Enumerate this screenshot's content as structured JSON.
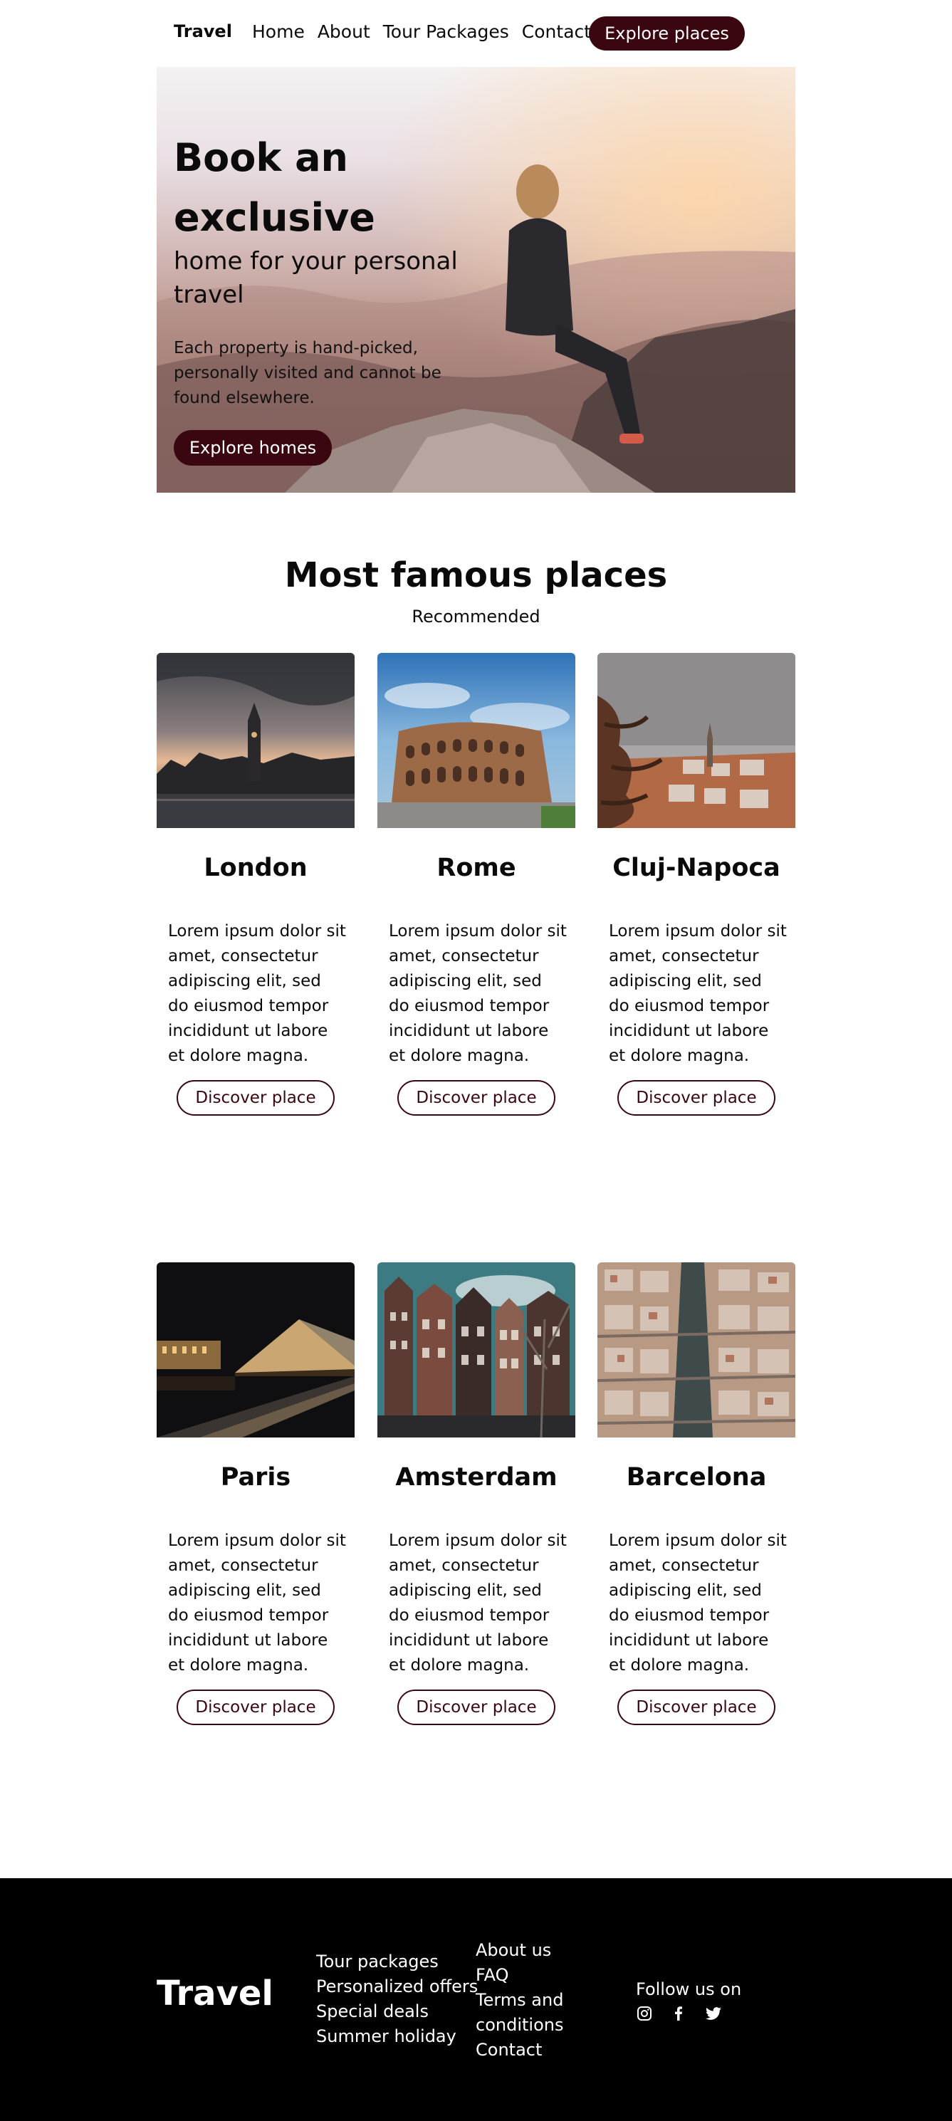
{
  "nav": {
    "brand": "Travel",
    "links": [
      "Home",
      "About",
      "Tour Packages",
      "Contact"
    ],
    "cta": "Explore places"
  },
  "hero": {
    "title": "Book an exclusive",
    "subtitle": "home for your personal travel",
    "description": "Each property is hand-picked, personally visited and cannot be found elsewhere.",
    "button": "Explore homes"
  },
  "places": {
    "title": "Most famous places",
    "subtitle": "Recommended",
    "cards": [
      {
        "name": "London",
        "desc": "Lorem ipsum dolor sit amet, consectetur adipiscing elit, sed do eiusmod tempor incididunt ut labore et dolore magna.",
        "button": "Discover place"
      },
      {
        "name": "Rome",
        "desc": "Lorem ipsum dolor sit amet, consectetur adipiscing elit, sed do eiusmod tempor incididunt ut labore et dolore magna.",
        "button": "Discover place"
      },
      {
        "name": "Cluj-Napoca",
        "desc": "Lorem ipsum dolor sit amet, consectetur adipiscing elit, sed do eiusmod tempor incididunt ut labore et dolore magna.",
        "button": "Discover place"
      },
      {
        "name": "Paris",
        "desc": "Lorem ipsum dolor sit amet, consectetur adipiscing elit, sed do eiusmod tempor incididunt ut labore et dolore magna.",
        "button": "Discover place"
      },
      {
        "name": "Amsterdam",
        "desc": "Lorem ipsum dolor sit amet, consectetur adipiscing elit, sed do eiusmod tempor incididunt ut labore et dolore magna.",
        "button": "Discover place"
      },
      {
        "name": "Barcelona",
        "desc": "Lorem ipsum dolor sit amet, consectetur adipiscing elit, sed do eiusmod tempor incididunt ut labore et dolore magna.",
        "button": "Discover place"
      }
    ]
  },
  "footer": {
    "logo": "Travel",
    "col1": [
      "Tour packages",
      "Personalized offers",
      "Special deals",
      "Summer holiday"
    ],
    "col2": [
      "About us",
      "FAQ",
      "Terms and",
      "conditions",
      "Contact"
    ],
    "follow": "Follow us on",
    "socials": [
      "instagram-icon",
      "facebook-icon",
      "twitter-icon"
    ]
  },
  "colors": {
    "accent": "#3a0710",
    "footer_bg": "#000000"
  }
}
